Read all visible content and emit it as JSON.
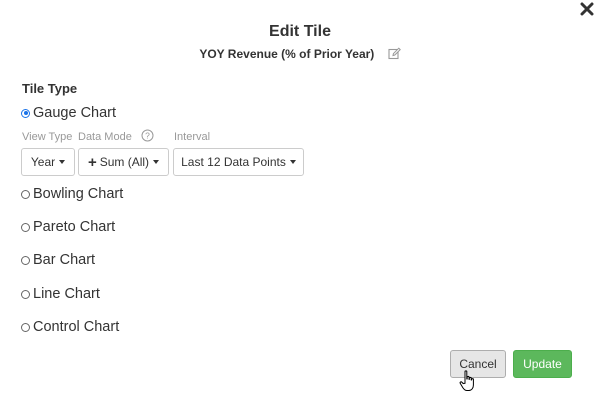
{
  "dialog": {
    "title": "Edit Tile",
    "subtitle": "YOY Revenue (% of Prior Year)"
  },
  "tile_type": {
    "label": "Tile Type",
    "options": [
      {
        "label": "Gauge Chart",
        "checked": true
      },
      {
        "label": "Bowling Chart",
        "checked": false
      },
      {
        "label": "Pareto Chart",
        "checked": false
      },
      {
        "label": "Bar Chart",
        "checked": false
      },
      {
        "label": "Line Chart",
        "checked": false
      },
      {
        "label": "Control Chart",
        "checked": false
      }
    ]
  },
  "gauge_options": {
    "view_type_label": "View Type",
    "data_mode_label": "Data Mode",
    "interval_label": "Interval",
    "view_type_value": "Year",
    "data_mode_value": "Sum (All)",
    "interval_value": "Last 12 Data Points"
  },
  "footer": {
    "cancel_label": "Cancel",
    "update_label": "Update"
  },
  "colors": {
    "accent": "#1a73e8",
    "update_button": "#5cb85c",
    "cancel_button": "#e6e6e6"
  },
  "icons": [
    "close-icon",
    "edit-icon",
    "help-icon",
    "plus-icon",
    "caret-down-icon",
    "hand-pointer-icon"
  ]
}
